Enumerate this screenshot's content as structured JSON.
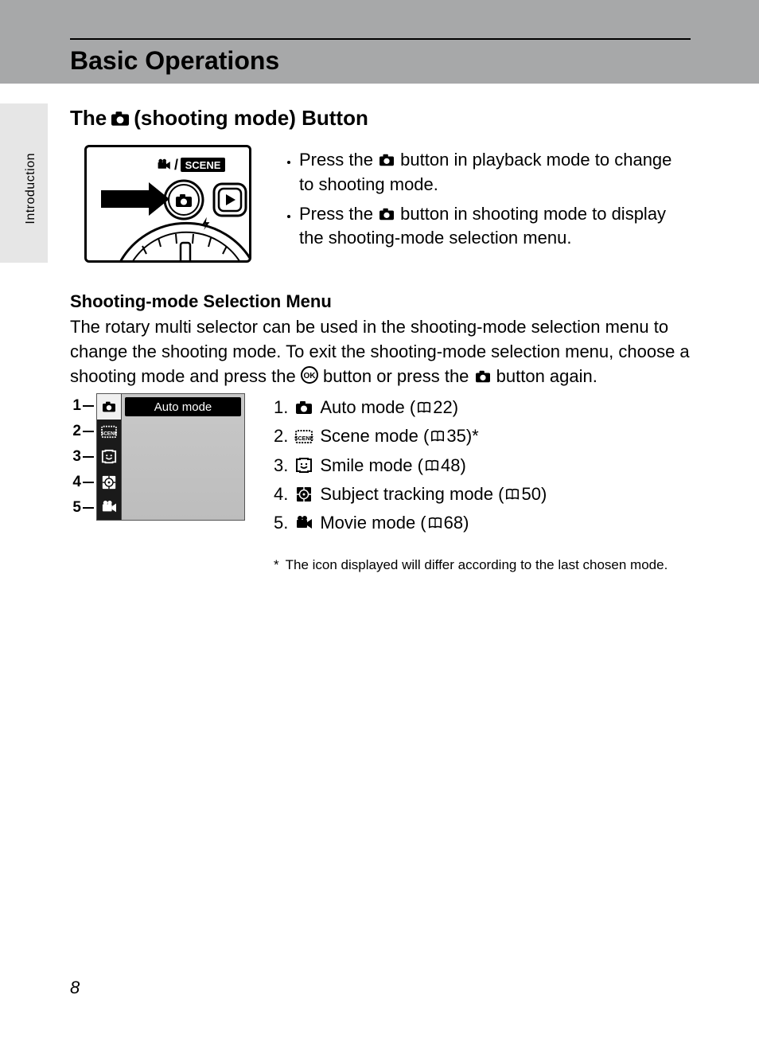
{
  "chapter_title": "Basic Operations",
  "side_label": "Introduction",
  "section_title_pre": "The ",
  "section_title_post": " (shooting mode) Button",
  "bullets": {
    "b1_pre": "Press the ",
    "b1_post": " button in playback mode to change to shooting mode.",
    "b2_pre": "Press the ",
    "b2_post": " button in shooting mode to display the shooting-mode selection menu."
  },
  "subsection_title": "Shooting-mode Selection Menu",
  "body_pre": "The rotary multi selector can be used in the shooting-mode selection menu to change the shooting mode. To exit the shooting-mode selection menu, choose a shooting mode and press the ",
  "body_mid": " button or press the ",
  "body_post": " button again.",
  "menu": {
    "nums": [
      "1",
      "2",
      "3",
      "4",
      "5"
    ],
    "selected_label": "Auto mode"
  },
  "modes": {
    "m1": {
      "n": "1.",
      "label": " Auto mode (",
      "page": "22",
      "tail": ")"
    },
    "m2": {
      "n": "2.",
      "label": " Scene mode (",
      "page": "35",
      "tail": ")*"
    },
    "m3": {
      "n": "3.",
      "label": " Smile mode (",
      "page": "48",
      "tail": ")"
    },
    "m4": {
      "n": "4.",
      "label": " Subject tracking mode (",
      "page": "50",
      "tail": ")"
    },
    "m5": {
      "n": "5.",
      "label": " Movie mode (",
      "page": "68",
      "tail": ")"
    }
  },
  "footnote_marker": "*",
  "footnote_text": "The icon displayed will differ according to the last chosen mode.",
  "page_number": "8",
  "diagram_labels": {
    "scene": "SCENE"
  }
}
